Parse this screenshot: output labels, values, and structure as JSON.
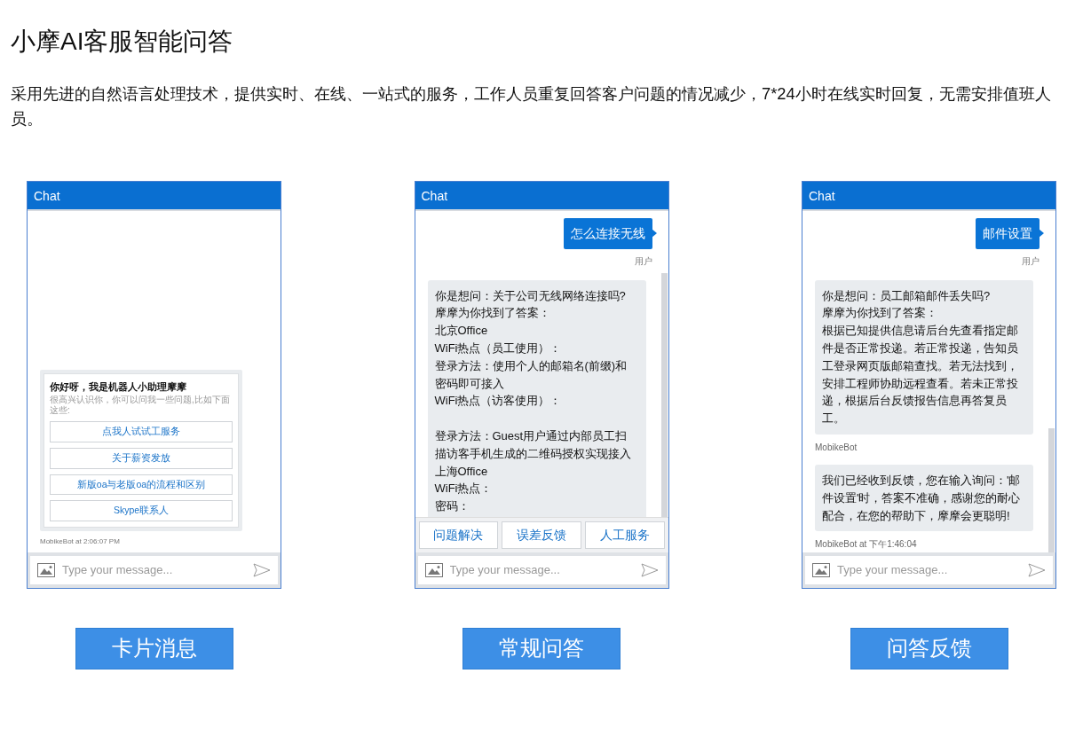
{
  "title": "小摩AI客服智能问答",
  "description": "采用先进的自然语言处理技术，提供实时、在线、一站式的服务，工作人员重复回答客户问题的情况减少，7*24小时在线实时回复，无需安排值班人员。",
  "panels": [
    {
      "header": "Chat",
      "messages": [
        {
          "kind": "card",
          "title": "你好呀，我是机器人小助理摩摩",
          "subtitle": "很高兴认识你，你可以问我一些问题,比如下面这些:",
          "options": [
            "点我人试试工服务",
            "关于薪资发放",
            "新版oa与老版oa的流程和区别",
            "Skype联系人"
          ],
          "footer": "MobikeBot at 2:06:07 PM"
        }
      ],
      "input": {
        "placeholder": "Type your message..."
      },
      "caption": "卡片消息"
    },
    {
      "header": "Chat",
      "messages": [
        {
          "kind": "user",
          "text": "怎么连接无线",
          "sender": "用户"
        },
        {
          "kind": "bot",
          "paragraphs": [
            [
              "你是想问：关于公司无线网络连接吗?",
              "摩摩为你找到了答案：",
              "北京Office",
              "WiFi热点（员工使用）：",
              "登录方法：使用个人的邮箱名(前缀)和",
              "密码即可接入",
              "WiFi热点（访客使用）："
            ],
            [
              "登录方法：Guest用户通过内部员工扫",
              "描访客手机生成的二维码授权实现接入",
              "上海Office",
              "WiFi热点：",
              "密码："
            ]
          ]
        }
      ],
      "quick_replies": [
        "问题解决",
        "误差反馈",
        "人工服务"
      ],
      "input": {
        "placeholder": "Type your message..."
      },
      "caption": "常规问答"
    },
    {
      "header": "Chat",
      "messages": [
        {
          "kind": "user",
          "text": "邮件设置",
          "sender": "用户"
        },
        {
          "kind": "bot",
          "paragraphs": [
            [
              "你是想问：员工邮箱邮件丢失吗?",
              "摩摩为你找到了答案：",
              "根据已知提供信息请后台先查看指定邮",
              "件是否正常投递。若正常投递，告知员",
              "工登录网页版邮箱查找。若无法找到，",
              "安排工程师协助远程查看。若未正常投",
              "递，根据后台反馈报告信息再答复员",
              "工。"
            ]
          ],
          "footer": "MobikeBot"
        },
        {
          "kind": "bot",
          "paragraphs": [
            [
              "我们已经收到反馈，您在输入询问：'邮",
              "件设置'时，答案不准确，感谢您的耐心",
              "配合，在您的帮助下，摩摩会更聪明!"
            ]
          ],
          "footer": "MobikeBot at 下午1:46:04"
        }
      ],
      "input": {
        "placeholder": "Type your message..."
      },
      "caption": "问答反馈"
    }
  ]
}
